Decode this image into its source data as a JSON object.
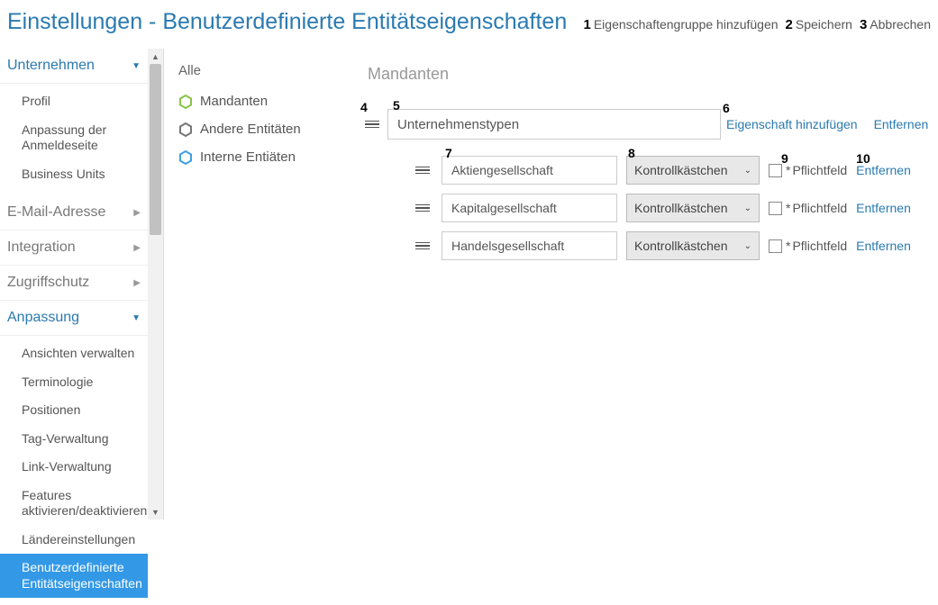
{
  "header": {
    "title": "Einstellungen - Benutzerdefinierte Entitätseigenschaften",
    "actions": {
      "addGroup": {
        "num": "1",
        "label": "Eigenschaftengruppe hinzufügen"
      },
      "save": {
        "num": "2",
        "label": "Speichern"
      },
      "cancel": {
        "num": "3",
        "label": "Abbrechen"
      }
    }
  },
  "sidebar": {
    "sections": [
      {
        "name": "unternehmen",
        "label": "Unternehmen",
        "expanded": true,
        "items": [
          {
            "label": "Profil"
          },
          {
            "label": "Anpassung der Anmeldeseite"
          },
          {
            "label": "Business Units"
          }
        ]
      },
      {
        "name": "email",
        "label": "E-Mail-Adresse",
        "expanded": false,
        "items": []
      },
      {
        "name": "integration",
        "label": "Integration",
        "expanded": false,
        "items": []
      },
      {
        "name": "zugriff",
        "label": "Zugriffschutz",
        "expanded": false,
        "items": []
      },
      {
        "name": "anpassung",
        "label": "Anpassung",
        "expanded": true,
        "items": [
          {
            "label": "Ansichten verwalten"
          },
          {
            "label": "Terminologie"
          },
          {
            "label": "Positionen"
          },
          {
            "label": "Tag-Verwaltung"
          },
          {
            "label": "Link-Verwaltung"
          },
          {
            "label": "Features aktivieren/deaktivieren"
          },
          {
            "label": "Ländereinstellungen"
          },
          {
            "label": "Benutzerdefinierte Entitätseigenschaften",
            "active": true
          }
        ]
      }
    ]
  },
  "entityCol": {
    "all": "Alle",
    "items": [
      {
        "label": "Mandanten",
        "color": "#8bc34a"
      },
      {
        "label": "Andere Entitäten",
        "color": "#777777"
      },
      {
        "label": "Interne Entiäten",
        "color": "#3fa0e0"
      }
    ]
  },
  "main": {
    "title": "Mandanten",
    "group": {
      "name": "Unternehmenstypen",
      "addProp": "Eigenschaft hinzufügen",
      "remove": "Entfernen"
    },
    "typeLabel": "Kontrollkästchen",
    "requiredLabel": "Pflichtfeld",
    "removeLabel": "Entfernen",
    "properties": [
      {
        "name": "Aktiengesellschaft"
      },
      {
        "name": "Kapitalgesellschaft"
      },
      {
        "name": "Handelsgesellschaft"
      }
    ],
    "annotations": {
      "a4": "4",
      "a5": "5",
      "a6": "6",
      "a7": "7",
      "a8": "8",
      "a9": "9",
      "a10": "10"
    }
  }
}
